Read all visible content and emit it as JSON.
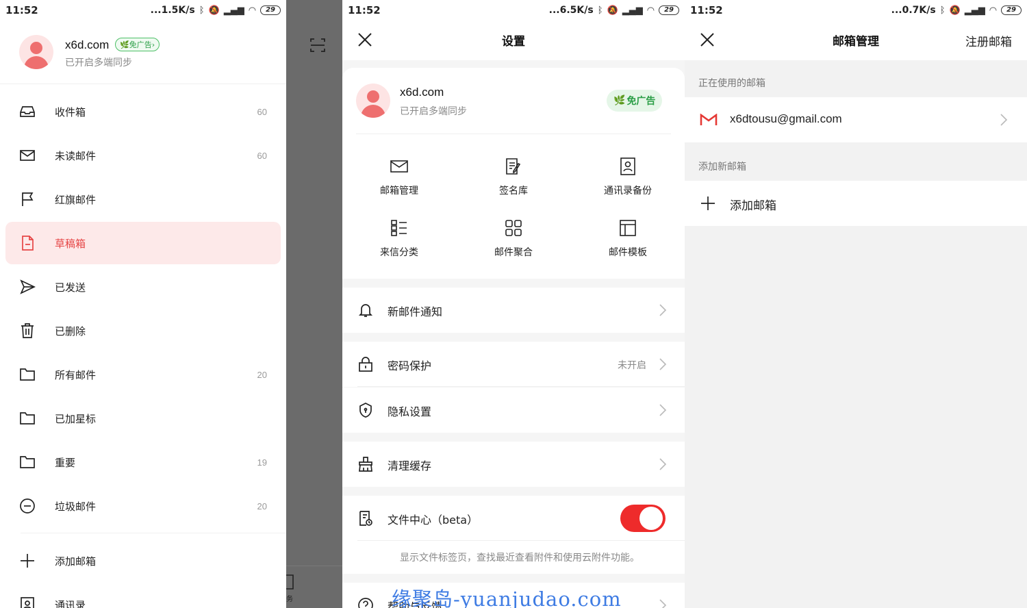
{
  "status_bars": [
    {
      "time": "11:52",
      "speed": "...1.5K/s",
      "battery": "29"
    },
    {
      "time": "11:52",
      "speed": "...6.5K/s",
      "battery": "29"
    },
    {
      "time": "11:52",
      "speed": "...0.7K/s",
      "battery": "29"
    }
  ],
  "drawer": {
    "account": {
      "name": "x6d.com",
      "badge": "免广告",
      "subtitle": "已开启多端同步"
    },
    "items": [
      {
        "label": "收件箱",
        "count": "60",
        "icon": "inbox-icon"
      },
      {
        "label": "未读邮件",
        "count": "60",
        "icon": "envelope-icon"
      },
      {
        "label": "红旗邮件",
        "count": "",
        "icon": "flag-icon"
      },
      {
        "label": "草稿箱",
        "count": "",
        "icon": "draft-icon",
        "active": true
      },
      {
        "label": "已发送",
        "count": "",
        "icon": "send-icon"
      },
      {
        "label": "已删除",
        "count": "",
        "icon": "trash-icon"
      },
      {
        "label": "所有邮件",
        "count": "20",
        "icon": "folder-icon"
      },
      {
        "label": "已加星标",
        "count": "",
        "icon": "folder-icon"
      },
      {
        "label": "重要",
        "count": "19",
        "icon": "folder-icon"
      },
      {
        "label": "垃圾邮件",
        "count": "20",
        "icon": "spam-icon"
      }
    ],
    "add_mailbox": "添加邮箱",
    "contacts": "通讯录",
    "overlay_task_label": "务"
  },
  "settings": {
    "title": "设置",
    "account": {
      "name": "x6d.com",
      "subtitle": "已开启多端同步",
      "badge": "免广告"
    },
    "grid": [
      {
        "label": "邮箱管理",
        "icon": "mailbox-icon"
      },
      {
        "label": "签名库",
        "icon": "signature-icon"
      },
      {
        "label": "通讯录备份",
        "icon": "contacts-backup-icon"
      },
      {
        "label": "来信分类",
        "icon": "sort-icon"
      },
      {
        "label": "邮件聚合",
        "icon": "aggregate-icon"
      },
      {
        "label": "邮件模板",
        "icon": "template-icon"
      }
    ],
    "rows": {
      "notify": "新邮件通知",
      "password": "密码保护",
      "password_value": "未开启",
      "privacy": "隐私设置",
      "cache": "清理缓存",
      "file_center": "文件中心（beta）",
      "file_center_desc": "显示文件标签页，查找最近查看附件和使用云附件功能。",
      "help": "帮助与反馈"
    },
    "watermark": "缘聚岛-yuanjudao.com"
  },
  "mailbox": {
    "title": "邮箱管理",
    "register": "注册邮箱",
    "in_use_label": "正在使用的邮箱",
    "email": "x6dtousu@gmail.com",
    "add_label": "添加新邮箱",
    "add_button": "添加邮箱"
  },
  "colors": {
    "accent_red": "#e64545",
    "toggle_red": "#ee2b2b",
    "green_badge": "#2a9e46",
    "overlay": "#6b6b6b"
  }
}
